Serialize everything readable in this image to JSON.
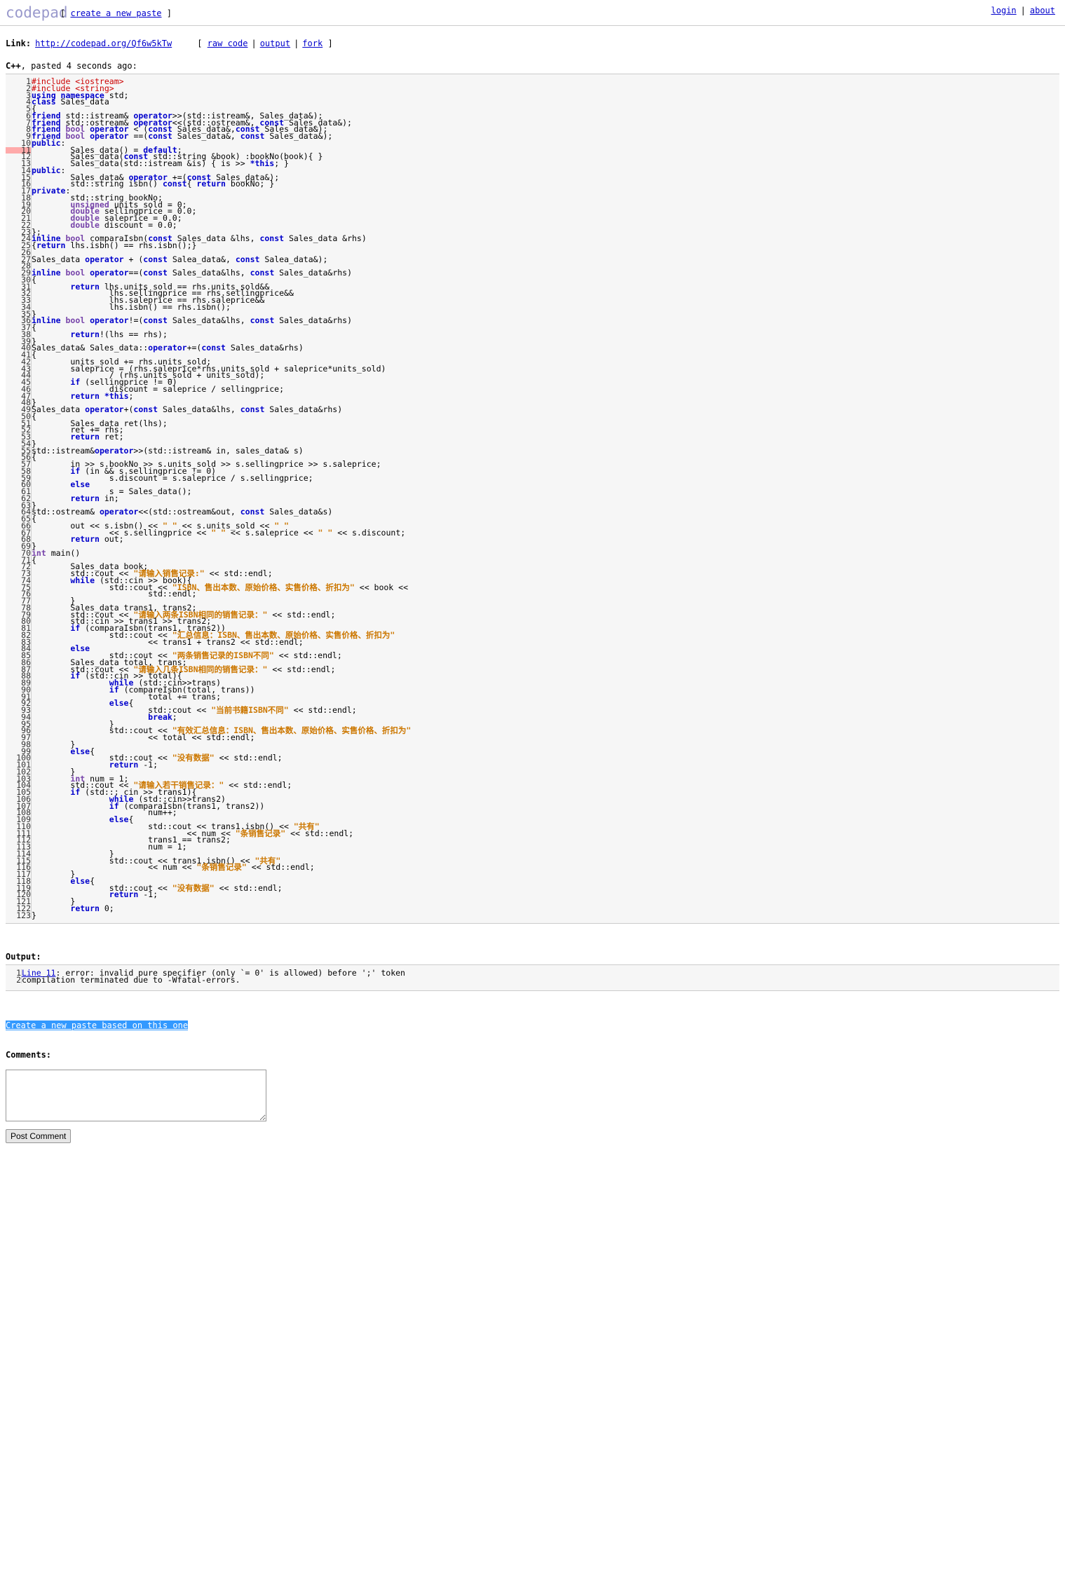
{
  "header": {
    "logo": "codepad",
    "new_paste_open": "[",
    "new_paste_label": "create a new paste",
    "new_paste_close": "]",
    "login_label": "login",
    "divider": "|",
    "about_label": "about"
  },
  "linkbar": {
    "label": "Link:",
    "url": "http://codepad.org/Qf6w5kTw",
    "open_bracket": "[",
    "raw_code_label": "raw code",
    "output_label": "output",
    "fork_label": "fork",
    "close_bracket": "]",
    "separator": "|"
  },
  "meta": {
    "language": "C++",
    "posted": ", pasted 4 seconds ago:"
  },
  "code": {
    "error_line": 11,
    "total_lines": 123,
    "lines": [
      "<span class=\"pp\">#include &lt;iostream&gt;</span>",
      "<span class=\"pp\">#include &lt;string&gt;</span>",
      "<span class=\"kw\">using namespace</span> std;",
      "<span class=\"kw\">class</span> Sales_data",
      "{",
      "<span class=\"kw\">friend</span> std::istream&amp; <span class=\"kw\">operator</span>&gt;&gt;(std::istream&amp;, Sales_data&amp;);",
      "<span class=\"kw\">friend</span> std::ostream&amp; <span class=\"kw\">operator</span>&lt;&lt;(std::ostream&amp;, <span class=\"kw\">const</span> Sales_data&amp;);",
      "<span class=\"kw\">friend</span> <span class=\"ty\">bool</span> <span class=\"kw\">operator</span> &lt; (<span class=\"kw\">const</span> Sales_data&amp;,<span class=\"kw\">const</span> Sales_data&amp;);",
      "<span class=\"kw\">friend</span> <span class=\"ty\">bool</span> <span class=\"kw\">operator</span> ==(<span class=\"kw\">const</span> Sales_data&amp;, <span class=\"kw\">const</span> Sales_data&amp;);",
      "<span class=\"kw\">public</span>:",
      "        Sales_data() = <span class=\"kw\">default</span>;",
      "        Sales_data(<span class=\"kw\">const</span> std::string &amp;book) :bookNo(book){ }",
      "        Sales_data(std::istream &amp;is) { is &gt;&gt; <span class=\"kw\">*this</span>; }",
      "<span class=\"kw\">public</span>:",
      "        Sales_data&amp; <span class=\"kw\">operator</span> +=(<span class=\"kw\">const</span> Sales_data&amp;);",
      "        std::string isbn() <span class=\"kw\">const</span>{ <span class=\"kw\">return</span> bookNo; }",
      "<span class=\"kw\">private</span>:",
      "        std::string bookNo;",
      "        <span class=\"ty\">unsigned</span> units_sold = 0;",
      "        <span class=\"ty\">double</span> sellingprice = 0.0;",
      "        <span class=\"ty\">double</span> saleprice = 0.0;",
      "        <span class=\"ty\">double</span> discount = 0.0;",
      "};",
      "<span class=\"kw\">inline</span> <span class=\"ty\">bool</span> comparaIsbn(<span class=\"kw\">const</span> Sales_data &amp;lhs, <span class=\"kw\">const</span> Sales_data &amp;rhs)",
      "{<span class=\"kw\">return</span> lhs.isbn() == rhs.isbn();}",
      "",
      "Sales_data <span class=\"kw\">operator</span> + (<span class=\"kw\">const</span> Salea_data&amp;, <span class=\"kw\">const</span> Salea_data&amp;);",
      "",
      "<span class=\"kw\">inline</span> <span class=\"ty\">bool</span> <span class=\"kw\">operator</span>==(<span class=\"kw\">const</span> Sales_data&amp;lhs, <span class=\"kw\">const</span> Sales_data&amp;rhs)",
      "{",
      "        <span class=\"kw\">return</span> lhs.units_sold == rhs.units_sold&amp;&amp;",
      "                lhs.sellingprice == rhs.sellingprice&amp;&amp;",
      "                lhs.saleprice == rhs.saleprice&amp;&amp;",
      "                lhs.isbn() == rhs.isbn();",
      "}",
      "<span class=\"kw\">inline</span> <span class=\"ty\">bool</span> <span class=\"kw\">operator</span>!=(<span class=\"kw\">const</span> Sales_data&amp;lhs, <span class=\"kw\">const</span> Sales_data&amp;rhs)",
      "{",
      "        <span class=\"kw\">return</span>!(lhs == rhs);",
      "}",
      "Sales_data&amp; Sales_data::<span class=\"kw\">operator</span>+=(<span class=\"kw\">const</span> Sales_data&amp;rhs)",
      "{",
      "        units_sold += rhs.units_sold;",
      "        saleprice = (rhs.saleprice*rhs.units_sold + saleprice*units_sold)",
      "                / (rhs.units_sold + units_sold);",
      "        <span class=\"kw\">if</span> (sellingprice != 0)",
      "                discount = saleprice / sellingprice;",
      "        <span class=\"kw\">return</span> <span class=\"kw\">*this</span>;",
      "}",
      "Sales_data <span class=\"kw\">operator</span>+(<span class=\"kw\">const</span> Sales_data&amp;lhs, <span class=\"kw\">const</span> Sales_data&amp;rhs)",
      "{",
      "        Sales_data ret(lhs);",
      "        ret += rhs;",
      "        <span class=\"kw\">return</span> ret;",
      "}",
      "std::istream&amp;<span class=\"kw\">operator</span>&gt;&gt;(std::istream&amp; in, sales_data&amp; s)",
      "{",
      "        in &gt;&gt; s.bookNo &gt;&gt; s.units_sold &gt;&gt; s.sellingprice &gt;&gt; s.saleprice;",
      "        <span class=\"kw\">if</span> (in &amp;&amp; s.sellingprice != 0)",
      "                s.discount = s.saleprice / s.sellingprice;",
      "        <span class=\"kw\">else</span>",
      "                s = Sales_data();",
      "        <span class=\"kw\">return</span> in;",
      "}",
      "std::ostream&amp; <span class=\"kw\">operator</span>&lt;&lt;(std::ostream&amp;out, <span class=\"kw\">const</span> Sales_data&amp;s)",
      "{",
      "        out &lt;&lt; s.isbn() &lt;&lt; <span class=\"st\">\" \"</span> &lt;&lt; s.units_sold &lt;&lt; <span class=\"st\">\" \"</span>",
      "                &lt;&lt; s.sellingprice &lt;&lt; <span class=\"st\">\" \"</span> &lt;&lt; s.saleprice &lt;&lt; <span class=\"st\">\" \"</span> &lt;&lt; s.discount;",
      "        <span class=\"kw\">return</span> out;",
      "}",
      "<span class=\"ty\">int</span> main()",
      "{",
      "        Sales_data book;",
      "        std::cout &lt;&lt; <span class=\"st\">\"请输入销售记录:\"</span> &lt;&lt; std::endl;",
      "        <span class=\"kw\">while</span> (std::cin &gt;&gt; book){",
      "                std::cout &lt;&lt; <span class=\"st\">\"ISBN、售出本数、原始价格、实售价格、折扣为\"</span> &lt;&lt; book &lt;&lt;",
      "                        std::endl;",
      "        }",
      "        Sales_data trans1, trans2;",
      "        std::cout &lt;&lt; <span class=\"st\">\"请输入两条ISBN相同的销售记录：\"</span> &lt;&lt; std::endl;",
      "        std::cin &gt;&gt; trans1 &gt;&gt; trans2;",
      "        <span class=\"kw\">if</span> (comparaIsbn(trans1, trans2))",
      "                std::cout &lt;&lt; <span class=\"st\">\"汇总信息：ISBN、售出本数、原始价格、实售价格、折扣为\"</span>",
      "                        &lt;&lt; trans1 + trans2 &lt;&lt; std::endl;",
      "        <span class=\"kw\">else</span>",
      "                std::cout &lt;&lt; <span class=\"st\">\"两条销售记录的ISBN不同\"</span> &lt;&lt; std::endl;",
      "        Sales_data total, trans;",
      "        std::cout &lt;&lt; <span class=\"st\">\"请输入几条ISBN相同的销售记录：\"</span> &lt;&lt; std::endl;",
      "        <span class=\"kw\">if</span> (std::cin &gt;&gt; total){",
      "                <span class=\"kw\">while</span> (std::cin&gt;&gt;trans)",
      "                <span class=\"kw\">if</span> (compareIsbn(total, trans))",
      "                        total += trans;",
      "                <span class=\"kw\">else</span>{",
      "                        std::cout &lt;&lt; <span class=\"st\">\"当前书籍ISBN不同\"</span> &lt;&lt; std::endl;",
      "                        <span class=\"kw\">break</span>;",
      "                }",
      "                std::cout &lt;&lt; <span class=\"st\">\"有效汇总信息：ISBN、售出本数、原始价格、实售价格、折扣为\"</span>",
      "                        &lt;&lt; total &lt;&lt; std::endl;",
      "        }",
      "        <span class=\"kw\">else</span>{",
      "                std::cout &lt;&lt; <span class=\"st\">\"没有数据\"</span> &lt;&lt; std::endl;",
      "                <span class=\"kw\">return</span> -1;",
      "        }",
      "        <span class=\"ty\">int</span> num = 1;",
      "        std::cout &lt;&lt; <span class=\"st\">\"请输入若干销售记录：\"</span> &lt;&lt; std::endl;",
      "        <span class=\"kw\">if</span> (std::; cin &gt;&gt; trans1){",
      "                <span class=\"kw\">while</span> (std::cin&gt;&gt;trans2)",
      "                <span class=\"kw\">if</span> (comparaIsbn(trans1, trans2))",
      "                        num++;",
      "                <span class=\"kw\">else</span>{",
      "                        std::cout &lt;&lt; trans1.isbn() &lt;&lt; <span class=\"st\">\"共有\"</span>",
      "                                &lt;&lt; num &lt;&lt; <span class=\"st\">\"条销售记录\"</span> &lt;&lt; std::endl;",
      "                        trans1 == trans2;",
      "                        num = 1;",
      "                }",
      "                std::cout &lt;&lt; trans1.isbn() &lt;&lt; <span class=\"st\">\"共有\"</span>",
      "                        &lt;&lt; num &lt;&lt; <span class=\"st\">\"条销售记录\"</span> &lt;&lt; std::endl;",
      "        }",
      "        <span class=\"kw\">else</span>{",
      "                std::cout &lt;&lt; <span class=\"st\">\"没有数据\"</span> &lt;&lt; std::endl;",
      "                <span class=\"kw\">return</span> -1;",
      "        }",
      "        <span class=\"kw\">return</span> 0;",
      "}"
    ]
  },
  "output": {
    "label": "Output:",
    "lines": [
      {
        "number": "1",
        "link": "Line 11",
        "text": ": error: invalid pure specifier (only `= 0' is allowed) before ';' token"
      },
      {
        "number": "2",
        "link": "",
        "text": "compilation terminated due to -Wfatal-errors."
      }
    ]
  },
  "footer": {
    "based_on_label": "Create a new paste based on this one",
    "comments_label": "Comments:",
    "comment_value": "",
    "comment_placeholder": "",
    "post_comment_label": "Post Comment"
  },
  "colors": {
    "logo": "#9999cc",
    "link": "#0000cc",
    "keyword": "#0000cc",
    "type": "#7744aa",
    "preprocessor": "#cc0000",
    "string": "#cc7700",
    "error_line_bg": "#ffaaaa",
    "selection_bg": "#3399ff",
    "code_bg": "#f6f6f6"
  }
}
